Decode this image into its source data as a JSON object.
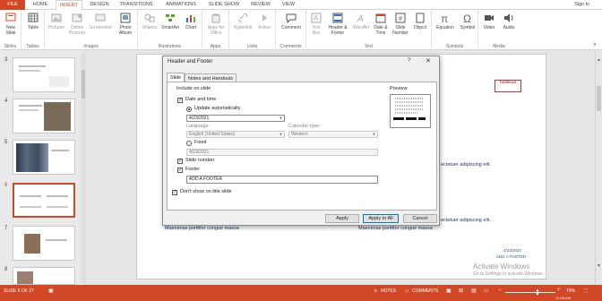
{
  "tabs": [
    "FILE",
    "HOME",
    "INSERT",
    "DESIGN",
    "TRANSITIONS",
    "ANIMATIONS",
    "SLIDE SHOW",
    "REVIEW",
    "VIEW"
  ],
  "sign_in": "Sign in",
  "ribbon": {
    "groups": [
      "Slides",
      "Tables",
      "Images",
      "Illustrations",
      "Apps",
      "Links",
      "Comments",
      "Text",
      "Symbols",
      "Media"
    ],
    "buttons": {
      "new_slide": "New Slide",
      "table": "Table",
      "pictures": "Pictures",
      "online_pictures": "Online Pictures",
      "screenshot": "Screenshot",
      "photo_album": "Photo Album",
      "shapes": "Shapes",
      "smartart": "SmartArt",
      "chart": "Chart",
      "apps_for_office": "Apps for Office",
      "hyperlink": "Hyperlink",
      "action": "Action",
      "comment": "Comment",
      "text_box": "Text Box",
      "header_footer": "Header & Footer",
      "wordart": "WordArt",
      "date_time": "Date & Time",
      "slide_number": "Slide Number",
      "object": "Object",
      "equation": "Equation",
      "symbol": "Symbol",
      "video": "Video",
      "audio": "Audio"
    }
  },
  "slide_numbers": [
    "3",
    "4",
    "5",
    "6",
    "7",
    "8"
  ],
  "slide": {
    "line1": "ectetuer adipiscing elit.",
    "line2": "ectetuer adipiscing elit.",
    "left_caption": "Maecenas porttitor congue massa",
    "right_caption": "Maecenas porttitor congue massa",
    "date": "4/23/2021",
    "footer": "ADD A FOOTER",
    "logo": "FABRIKAM"
  },
  "dialog": {
    "title": "Header and Footer",
    "help": "?",
    "close": "✕",
    "tabs": [
      "Slide",
      "Notes and Handouts"
    ],
    "include_label": "Include on slide",
    "date_time": "Date and time",
    "update_auto": "Update automatically",
    "date_value": "4/23/2021",
    "language_label": "Language:",
    "language_value": "English (United States)",
    "calendar_label": "Calendar type:",
    "calendar_value": "Western",
    "fixed": "Fixed",
    "fixed_value": "4/23/2021",
    "slide_number": "Slide number",
    "footer": "Footer",
    "footer_value": "ADD A FOOTER",
    "dont_show": "Don't show on title slide",
    "preview": "Preview",
    "apply": "Apply",
    "apply_all": "Apply to All",
    "cancel": "Cancel"
  },
  "status": {
    "slide_of": "SLIDE 6 OF 27",
    "notes": "NOTES",
    "comments": "COMMENTS",
    "zoom": "74%",
    "time": "12:26 AM"
  },
  "watermark": {
    "title": "Activate Windows",
    "sub": "Go to Settings to activate Windows."
  },
  "colors": {
    "accent": "#d24726",
    "dialog_bg": "#f0f0f0",
    "link": "#1f3864"
  }
}
